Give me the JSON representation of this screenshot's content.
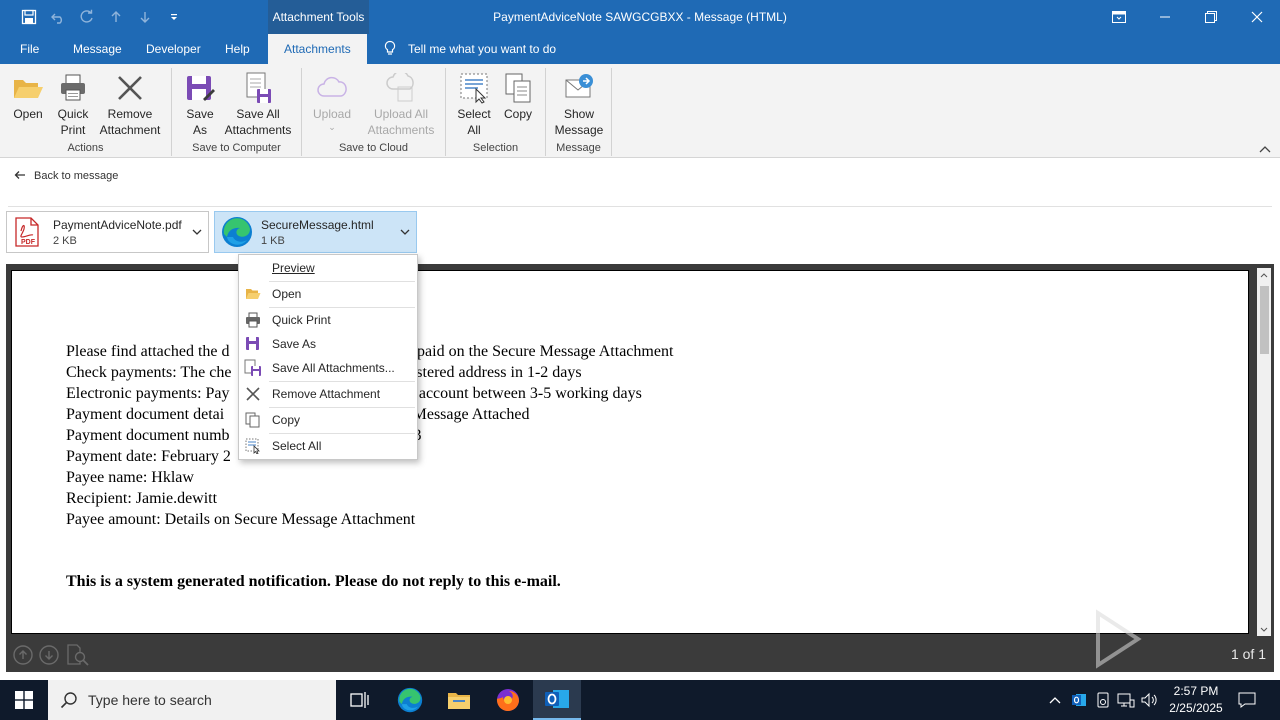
{
  "window": {
    "context_label": "Attachment Tools",
    "title": "PaymentAdviceNote SAWGCGBXX  -  Message (HTML)"
  },
  "tabs": [
    {
      "label": "File"
    },
    {
      "label": "Message"
    },
    {
      "label": "Developer"
    },
    {
      "label": "Help"
    },
    {
      "label": "Attachments",
      "active": true
    }
  ],
  "tellme": {
    "placeholder": "Tell me what you want to do"
  },
  "ribbon": {
    "groups": [
      {
        "label": "Actions",
        "buttons": [
          {
            "label1": "Open",
            "label2": "",
            "icon": "folder-open-icon"
          },
          {
            "label1": "Quick",
            "label2": "Print",
            "icon": "printer-icon"
          },
          {
            "label1": "Remove",
            "label2": "Attachment",
            "icon": "remove-x-icon"
          }
        ]
      },
      {
        "label": "Save to Computer",
        "buttons": [
          {
            "label1": "Save",
            "label2": "As",
            "icon": "save-as-icon"
          },
          {
            "label1": "Save All",
            "label2": "Attachments",
            "icon": "save-all-icon"
          }
        ]
      },
      {
        "label": "Save to Cloud",
        "buttons": [
          {
            "label1": "Upload",
            "label2": "",
            "icon": "cloud-upload-icon",
            "disabled": true
          },
          {
            "label1": "Upload All",
            "label2": "Attachments",
            "icon": "cloud-upload-all-icon",
            "disabled": true
          }
        ]
      },
      {
        "label": "Selection",
        "buttons": [
          {
            "label1": "Select",
            "label2": "All",
            "icon": "select-all-icon"
          },
          {
            "label1": "Copy",
            "label2": "",
            "icon": "copy-icon"
          }
        ]
      },
      {
        "label": "Message",
        "buttons": [
          {
            "label1": "Show",
            "label2": "Message",
            "icon": "show-message-icon"
          }
        ]
      }
    ]
  },
  "back_link": {
    "label": "Back to message"
  },
  "attachments": [
    {
      "name": "PaymentAdviceNote.pdf",
      "size": "2 KB",
      "icon": "pdf-file-icon",
      "icon_text": "PDF",
      "selected": false
    },
    {
      "name": "SecureMessage.html",
      "size": "1 KB",
      "icon": "edge-browser-icon",
      "selected": true
    }
  ],
  "context_menu": {
    "items": [
      {
        "label": "Preview",
        "icon": ""
      },
      {
        "label": "Open",
        "icon": "folder-open-icon"
      },
      {
        "label": "Quick Print",
        "icon": "printer-icon"
      },
      {
        "label": "Save As",
        "icon": "save-as-icon"
      },
      {
        "label": "Save All Attachments...",
        "icon": "save-all-icon"
      },
      {
        "label": "Remove Attachment",
        "icon": "remove-x-icon"
      },
      {
        "label": "Copy",
        "icon": "copy-icon"
      },
      {
        "label": "Select All",
        "icon": "select-all-icon"
      }
    ]
  },
  "document": {
    "lines": [
      "Please find attached the d                                         are paid on the Secure Message Attachment",
      "Check payments: The che                                        registered address in 1-2 days",
      "Electronic payments: Pay                                       your account between 3-5 working days",
      "Payment document detai                                         ure Message Attached",
      "Payment document numb                                          893",
      "Payment date: February 2",
      "Payee name: Hklaw",
      "Recipient: Jamie.dewitt",
      "Payee amount: Details on Secure Message Attachment"
    ],
    "notice": "This is a system generated notification. Please do not reply to this e-mail."
  },
  "preview_bar": {
    "page_count": "1 of 1",
    "watermark": "ANY RUN"
  },
  "taskbar": {
    "search_placeholder": "Type here to search",
    "time": "2:57 PM",
    "date": "2/25/2025"
  },
  "colors": {
    "title_bar": "#1f6ab5",
    "context_tab": "#245d97",
    "ribbon_bg": "#f3f3f3",
    "selected_attachment": "#cce4f7",
    "preview_frame": "#3b3b3b",
    "taskbar": "#0f1a2b"
  }
}
